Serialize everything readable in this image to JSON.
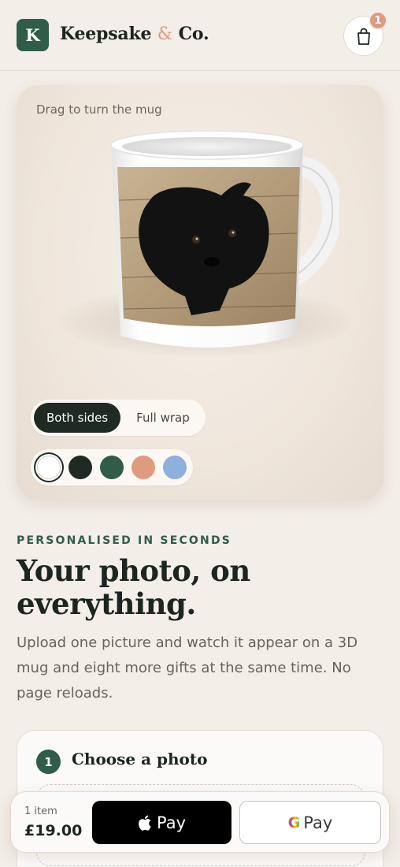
{
  "header": {
    "logo_letter": "K",
    "brand_name_1": "Keepsake",
    "brand_amp": "&",
    "brand_name_2": "Co.",
    "cart_count": "1"
  },
  "preview": {
    "drag_hint": "Drag to turn the mug",
    "view_options": [
      "Both sides",
      "Full wrap"
    ],
    "active_view": "Both sides",
    "colors": [
      "#ffffff",
      "#1f2a24",
      "#2f5d48",
      "#e09b7f",
      "#8fb0dc"
    ],
    "selected_color": "#ffffff"
  },
  "intro": {
    "eyebrow": "PERSONALISED IN SECONDS",
    "headline_line1": "Your photo, on",
    "headline_line2": "everything.",
    "lede": "Upload one picture and watch it appear on a 3D mug and eight more gifts at the same time. No page reloads."
  },
  "step": {
    "number": "1",
    "title": "Choose a photo"
  },
  "checkout": {
    "item_count": "1 item",
    "price": "£19.00",
    "apple_pay_label": "Pay",
    "google_pay_label": "Pay",
    "google_letter": "G"
  }
}
